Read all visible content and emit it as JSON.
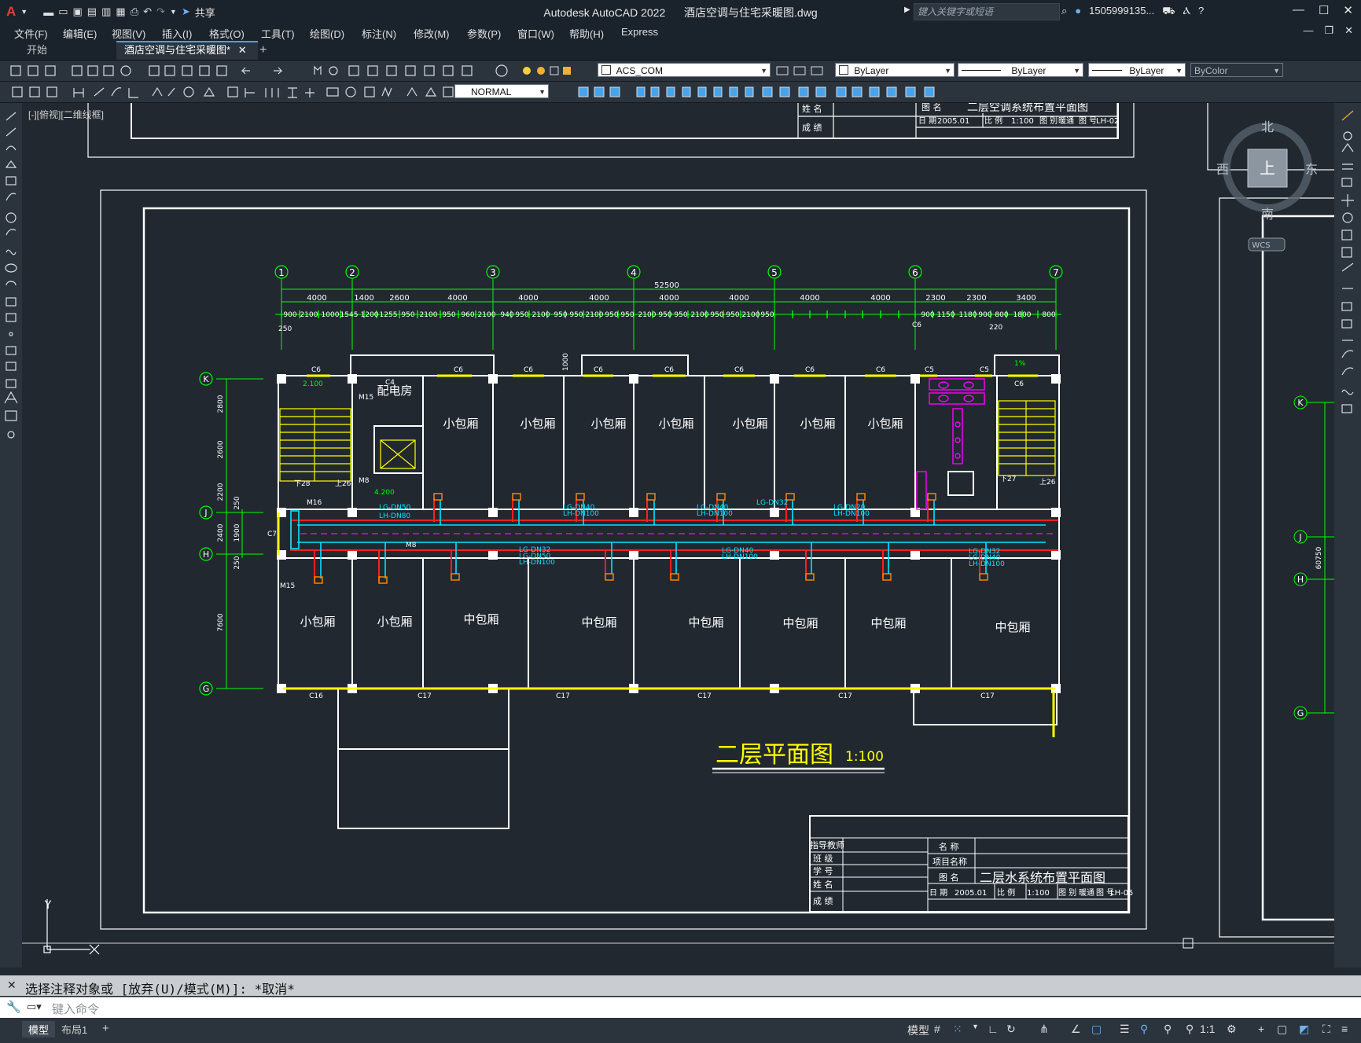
{
  "window": {
    "app_title": "Autodesk AutoCAD 2022",
    "file_name": "酒店空调与住宅采暖图.dwg",
    "share_label": "共享",
    "search_placeholder": "键入关键字或短语",
    "user": "1505999135...",
    "logo": "A"
  },
  "menu": [
    "文件(F)",
    "编辑(E)",
    "视图(V)",
    "插入(I)",
    "格式(O)",
    "工具(T)",
    "绘图(D)",
    "标注(N)",
    "修改(M)",
    "参数(P)",
    "窗口(W)",
    "帮助(H)",
    "Express"
  ],
  "tabs": [
    {
      "label": "开始",
      "active": false
    },
    {
      "label": "酒店空调与住宅采暖图*",
      "active": true
    }
  ],
  "toolbar": {
    "layer": "ACS_COM",
    "color": "ByLayer",
    "linetype": "ByLayer",
    "lineweight": "ByLayer",
    "plotstyle": "ByColor",
    "dimstyle": "NORMAL"
  },
  "viewport_label": "[-][俯视][二维线框]",
  "viewcube": {
    "top": "上",
    "north": "北",
    "south": "南",
    "east": "东",
    "west": "西",
    "wcs": "WCS"
  },
  "drawing": {
    "main_title": "二层平面图",
    "scale": "1:100",
    "axes_columns": [
      "1",
      "2",
      "3",
      "4",
      "5",
      "6",
      "7"
    ],
    "axes_rows": [
      "K",
      "J",
      "H",
      "G"
    ],
    "overall_dim": "52500",
    "dims_top": [
      "4000",
      "1400",
      "2600",
      "4000",
      "4000",
      "4000",
      "4000",
      "4000",
      "4000",
      "4000",
      "2300",
      "2300",
      "3400"
    ],
    "dims_detail": [
      "900",
      "2100",
      "1000",
      "1545",
      "1200",
      "1255",
      "950",
      "2100",
      "950",
      "960",
      "2100",
      "940",
      "950",
      "2100",
      "950",
      "950",
      "2100",
      "950",
      "950",
      "2100",
      "950",
      "950",
      "2100",
      "950",
      "950",
      "2100",
      "950",
      "900",
      "1150",
      "1180",
      "900",
      "800",
      "1800",
      "800"
    ],
    "dims_left": [
      "2800",
      "2600",
      "2200",
      "2400",
      "7600"
    ],
    "dims_left_small": [
      "250",
      "1900",
      "250"
    ],
    "rooms_north": [
      "小包厢",
      "小包厢",
      "小包厢",
      "小包厢",
      "小包厢",
      "小包厢",
      "小包厢"
    ],
    "rooms_south": [
      "小包厢",
      "小包厢",
      "中包厢",
      "中包厢",
      "中包厢",
      "中包厢",
      "中包厢",
      "中包厢"
    ],
    "room_power": "配电房",
    "window_tags_top": [
      "C6",
      "C4",
      "C6",
      "C6",
      "C6",
      "C6",
      "C6",
      "C6",
      "C6",
      "C5",
      "C5",
      "C6"
    ],
    "window_tags_bottom": [
      "C16",
      "C17",
      "C17",
      "C17",
      "C17",
      "C17"
    ],
    "pipe_tags": [
      "LG-DN40",
      "LH-DN100",
      "LG-DN40",
      "LH-DN100",
      "LG-DN32",
      "LG-DN20",
      "LH-DN100",
      "LG-DN50",
      "LH-DN80",
      "LG-DN32",
      "LG-DN50",
      "LH-DN100",
      "LG-DN40",
      "LH-DN100",
      "LG-DN32",
      "LG-DN40",
      "LH-DN100"
    ],
    "misc_tags": [
      "2.100",
      "4.200",
      "M15",
      "M8",
      "M16",
      "M15",
      "M8",
      "C7",
      "下28",
      "上26",
      "下27",
      "上26",
      "1000",
      "1%",
      "250",
      "220",
      "C6"
    ]
  },
  "titleblock_bottom": {
    "left_labels": [
      "指导教师",
      "班 级",
      "学 号",
      "姓 名",
      "成 绩"
    ],
    "right_labels": [
      "名 称",
      "项目名称",
      "图 名"
    ],
    "drawing_name": "二层水系统布置平面图",
    "date_label": "日 期",
    "date": "2005.01",
    "scale_label": "比 例",
    "scale": "1:100",
    "number_label": "图 别",
    "discipline": "暖通",
    "sheet_label": "图 号",
    "sheet": "LH-05"
  },
  "titleblock_top": {
    "labels": [
      "姓 名",
      "成 绩",
      "图 名",
      "日 期",
      "比 例",
      "图 别",
      "图 号"
    ],
    "date": "2005.01",
    "scale": "1:100",
    "discipline": "暖通",
    "sheet": "LH-02",
    "drawing_name": "二层空调系统布置平面图"
  },
  "right_sheet": {
    "axes": [
      "K",
      "J",
      "H",
      "G"
    ],
    "dim": "60750"
  },
  "ucs": {
    "y": "Y",
    "x": "X"
  },
  "command": {
    "history": "选择注释对象或 [放弃(U)/模式(M)]: *取消*",
    "placeholder": "键入命令"
  },
  "status": {
    "tabs": [
      "模型",
      "布局1"
    ],
    "model_label": "模型",
    "scale": "1:1"
  }
}
